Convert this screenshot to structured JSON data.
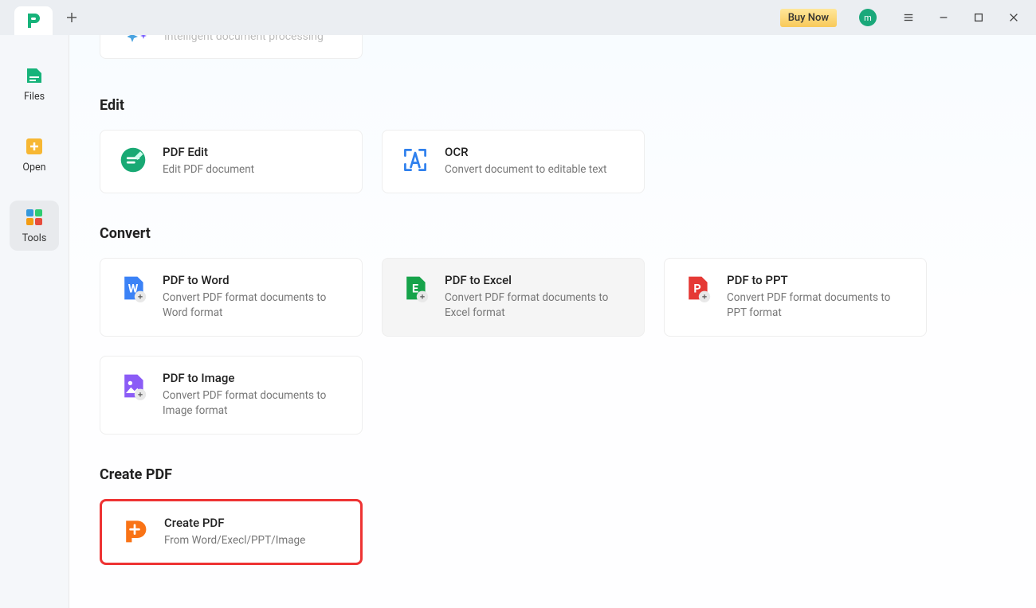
{
  "titlebar": {
    "buy_now": "Buy Now",
    "avatar_letter": "m"
  },
  "sidebar": {
    "items": [
      {
        "label": "Files"
      },
      {
        "label": "Open"
      },
      {
        "label": "Tools"
      }
    ]
  },
  "partial": {
    "ghost_text": "Intelligent document processing"
  },
  "sections": {
    "edit": {
      "title": "Edit",
      "cards": [
        {
          "title": "PDF Edit",
          "desc": "Edit PDF document"
        },
        {
          "title": "OCR",
          "desc": "Convert document to editable text"
        }
      ]
    },
    "convert": {
      "title": "Convert",
      "cards": [
        {
          "title": "PDF to Word",
          "desc": "Convert PDF format documents to Word format"
        },
        {
          "title": "PDF to Excel",
          "desc": "Convert PDF format documents to Excel format"
        },
        {
          "title": "PDF to PPT",
          "desc": "Convert PDF format documents to PPT format"
        },
        {
          "title": "PDF to Image",
          "desc": "Convert PDF format documents to Image format"
        }
      ]
    },
    "create": {
      "title": "Create PDF",
      "cards": [
        {
          "title": "Create PDF",
          "desc": "From Word/Execl/PPT/Image"
        }
      ]
    }
  }
}
